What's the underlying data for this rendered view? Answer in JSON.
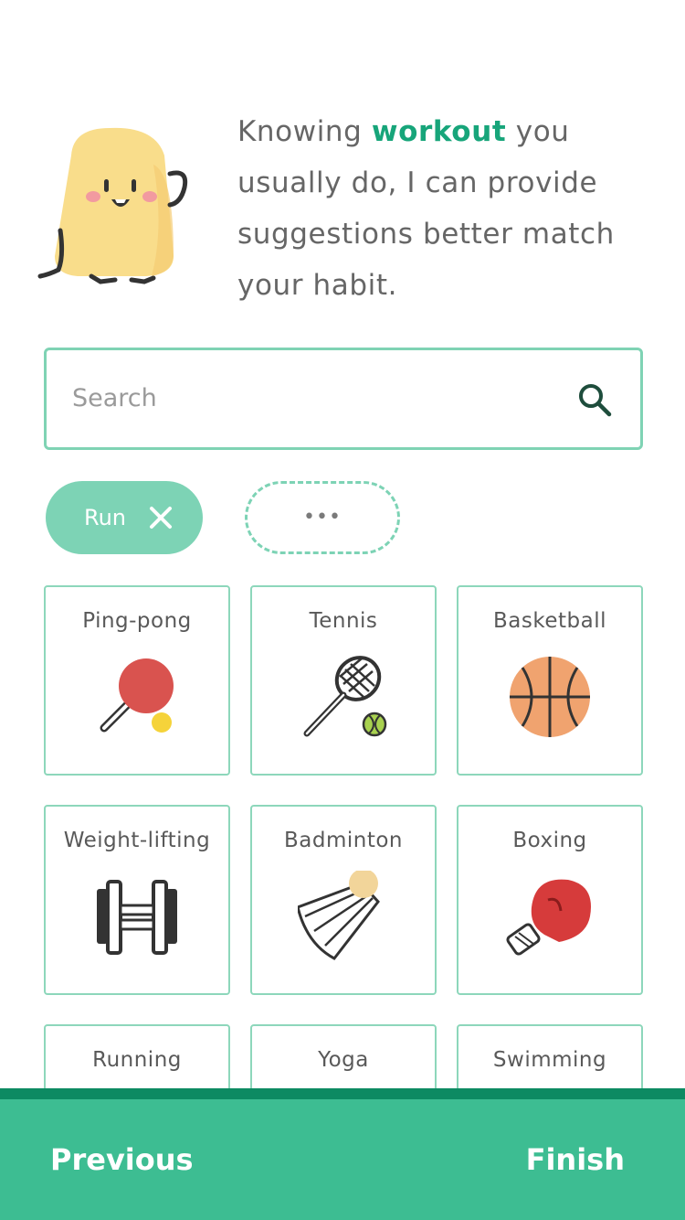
{
  "intro": {
    "before": "Knowing ",
    "highlight": "workout",
    "after": " you usually do, I can provide suggestions better match your habit."
  },
  "search": {
    "placeholder": "Search",
    "icon": "search-icon"
  },
  "chips": {
    "selected_label": "Run",
    "remove_icon": "close-icon",
    "more_label": "•••"
  },
  "workouts": [
    {
      "label": "Ping-pong",
      "icon": "ping-pong-paddle-icon"
    },
    {
      "label": "Tennis",
      "icon": "tennis-racket-icon"
    },
    {
      "label": "Basketball",
      "icon": "basketball-icon"
    },
    {
      "label": "Weight-lifting",
      "icon": "dumbbell-icon"
    },
    {
      "label": "Badminton",
      "icon": "shuttlecock-icon"
    },
    {
      "label": "Boxing",
      "icon": "boxing-glove-icon"
    },
    {
      "label": "Running",
      "icon": ""
    },
    {
      "label": "Yoga",
      "icon": ""
    },
    {
      "label": "Swimming",
      "icon": ""
    }
  ],
  "footer": {
    "previous_label": "Previous",
    "finish_label": "Finish"
  },
  "colors": {
    "accent": "#17a57a",
    "chip": "#7dd3b5",
    "border": "#8dd7bb",
    "footer": "#3dbd92",
    "footer_edge": "#0d8a62"
  }
}
